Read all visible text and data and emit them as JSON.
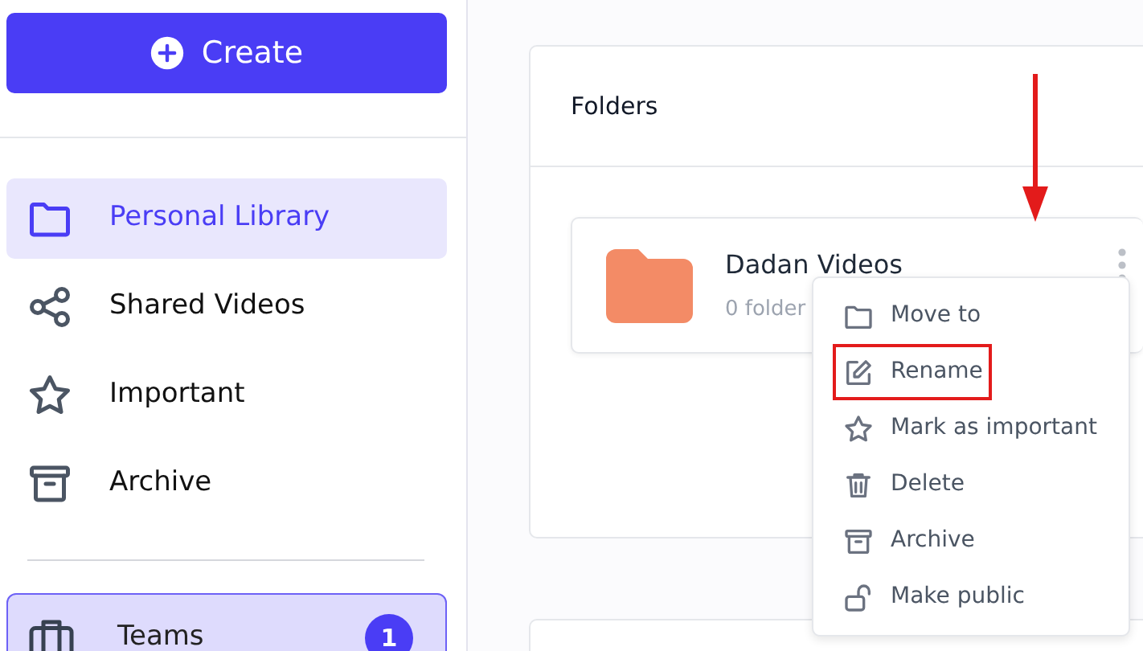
{
  "sidebar": {
    "create_button": "Create",
    "items": [
      {
        "label": "Personal Library",
        "selected": true
      },
      {
        "label": "Shared Videos",
        "selected": false
      },
      {
        "label": "Important",
        "selected": false
      },
      {
        "label": "Archive",
        "selected": false
      }
    ],
    "teams": {
      "label": "Teams",
      "badge": "1"
    }
  },
  "folders_panel": {
    "title": "Folders",
    "folders": [
      {
        "name": "Dadan Videos",
        "meta": "0 folder"
      }
    ]
  },
  "context_menu": [
    {
      "label": "Move to",
      "highlighted": false
    },
    {
      "label": "Rename",
      "highlighted": true
    },
    {
      "label": "Mark as important",
      "highlighted": false
    },
    {
      "label": "Delete",
      "highlighted": false
    },
    {
      "label": "Archive",
      "highlighted": false
    },
    {
      "label": "Make public",
      "highlighted": false
    }
  ]
}
